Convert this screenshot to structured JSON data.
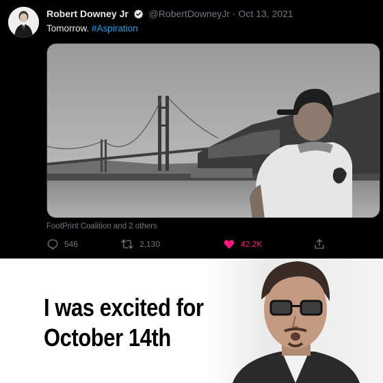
{
  "tweet": {
    "author_name": "Robert Downey Jr",
    "handle": "@RobertDowneyJr",
    "separator": "·",
    "date": "Oct 13, 2021",
    "text": "Tomorrow.",
    "hashtag": "#Aspiration",
    "tagged": "FootPrint Coalition and 2 others",
    "actions": {
      "reply_count": "546",
      "retweet_count": "2,130",
      "like_count": "42.2K"
    },
    "icons": [
      "verified-badge-icon",
      "reply-icon",
      "retweet-icon",
      "like-icon",
      "share-icon"
    ],
    "colors": {
      "hashtag": "#1da1f2",
      "like": "#f91880",
      "verified": "#1d9bf0"
    }
  },
  "meme": {
    "caption_line1": "I was excited for",
    "caption_line2": "October 14th"
  }
}
